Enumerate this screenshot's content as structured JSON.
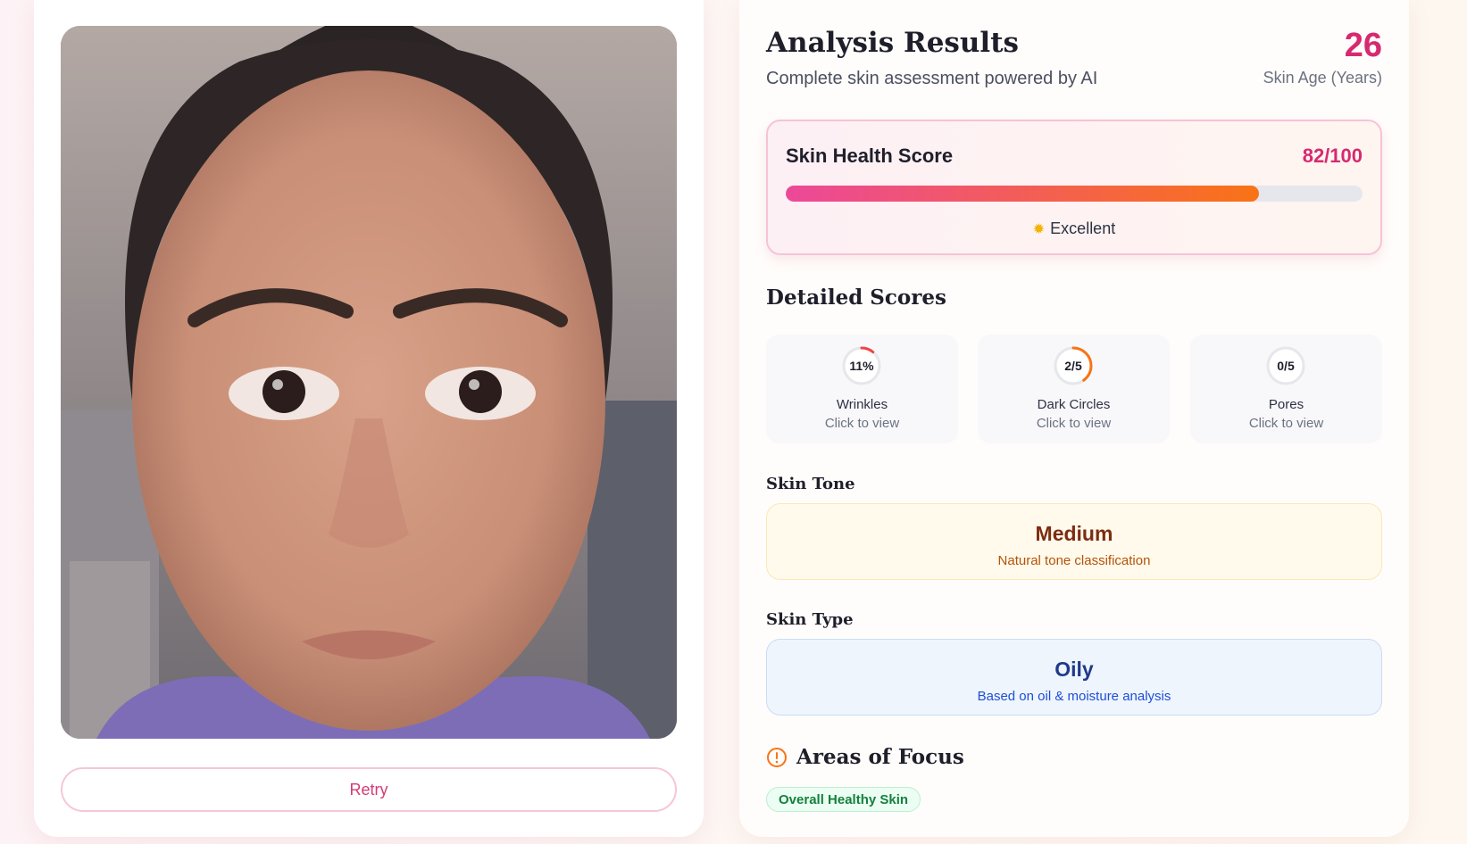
{
  "photo": {
    "description_icon": "face-photo"
  },
  "retry_label": "Retry",
  "results": {
    "title": "Analysis Results",
    "subtitle": "Complete skin assessment powered by AI",
    "skin_age_value": "26",
    "skin_age_label": "Skin Age (Years)"
  },
  "health": {
    "title": "Skin Health Score",
    "value_text": "82/100",
    "score": 82,
    "max": 100,
    "label": "Excellent",
    "icon": "sun-icon"
  },
  "detailed": {
    "title": "Detailed Scores",
    "items": [
      {
        "value_text": "11%",
        "fraction": 0.11,
        "ring_color": "#ef4444",
        "name": "Wrinkles",
        "hint": "Click to view"
      },
      {
        "value_text": "2/5",
        "fraction": 0.4,
        "ring_color": "#f97316",
        "name": "Dark Circles",
        "hint": "Click to view"
      },
      {
        "value_text": "0/5",
        "fraction": 0,
        "ring_color": "#22c55e",
        "name": "Pores",
        "hint": "Click to view"
      }
    ]
  },
  "tone": {
    "label": "Skin Tone",
    "value": "Medium",
    "desc": "Natural tone classification"
  },
  "type": {
    "label": "Skin Type",
    "value": "Oily",
    "desc": "Based on oil & moisture analysis"
  },
  "focus": {
    "title": "Areas of Focus",
    "icon": "alert-circle-icon",
    "tags": [
      "Overall Healthy Skin"
    ]
  },
  "colors": {
    "accent": "#d52a6f",
    "bar_start": "#ec4899",
    "bar_end": "#f97316"
  }
}
